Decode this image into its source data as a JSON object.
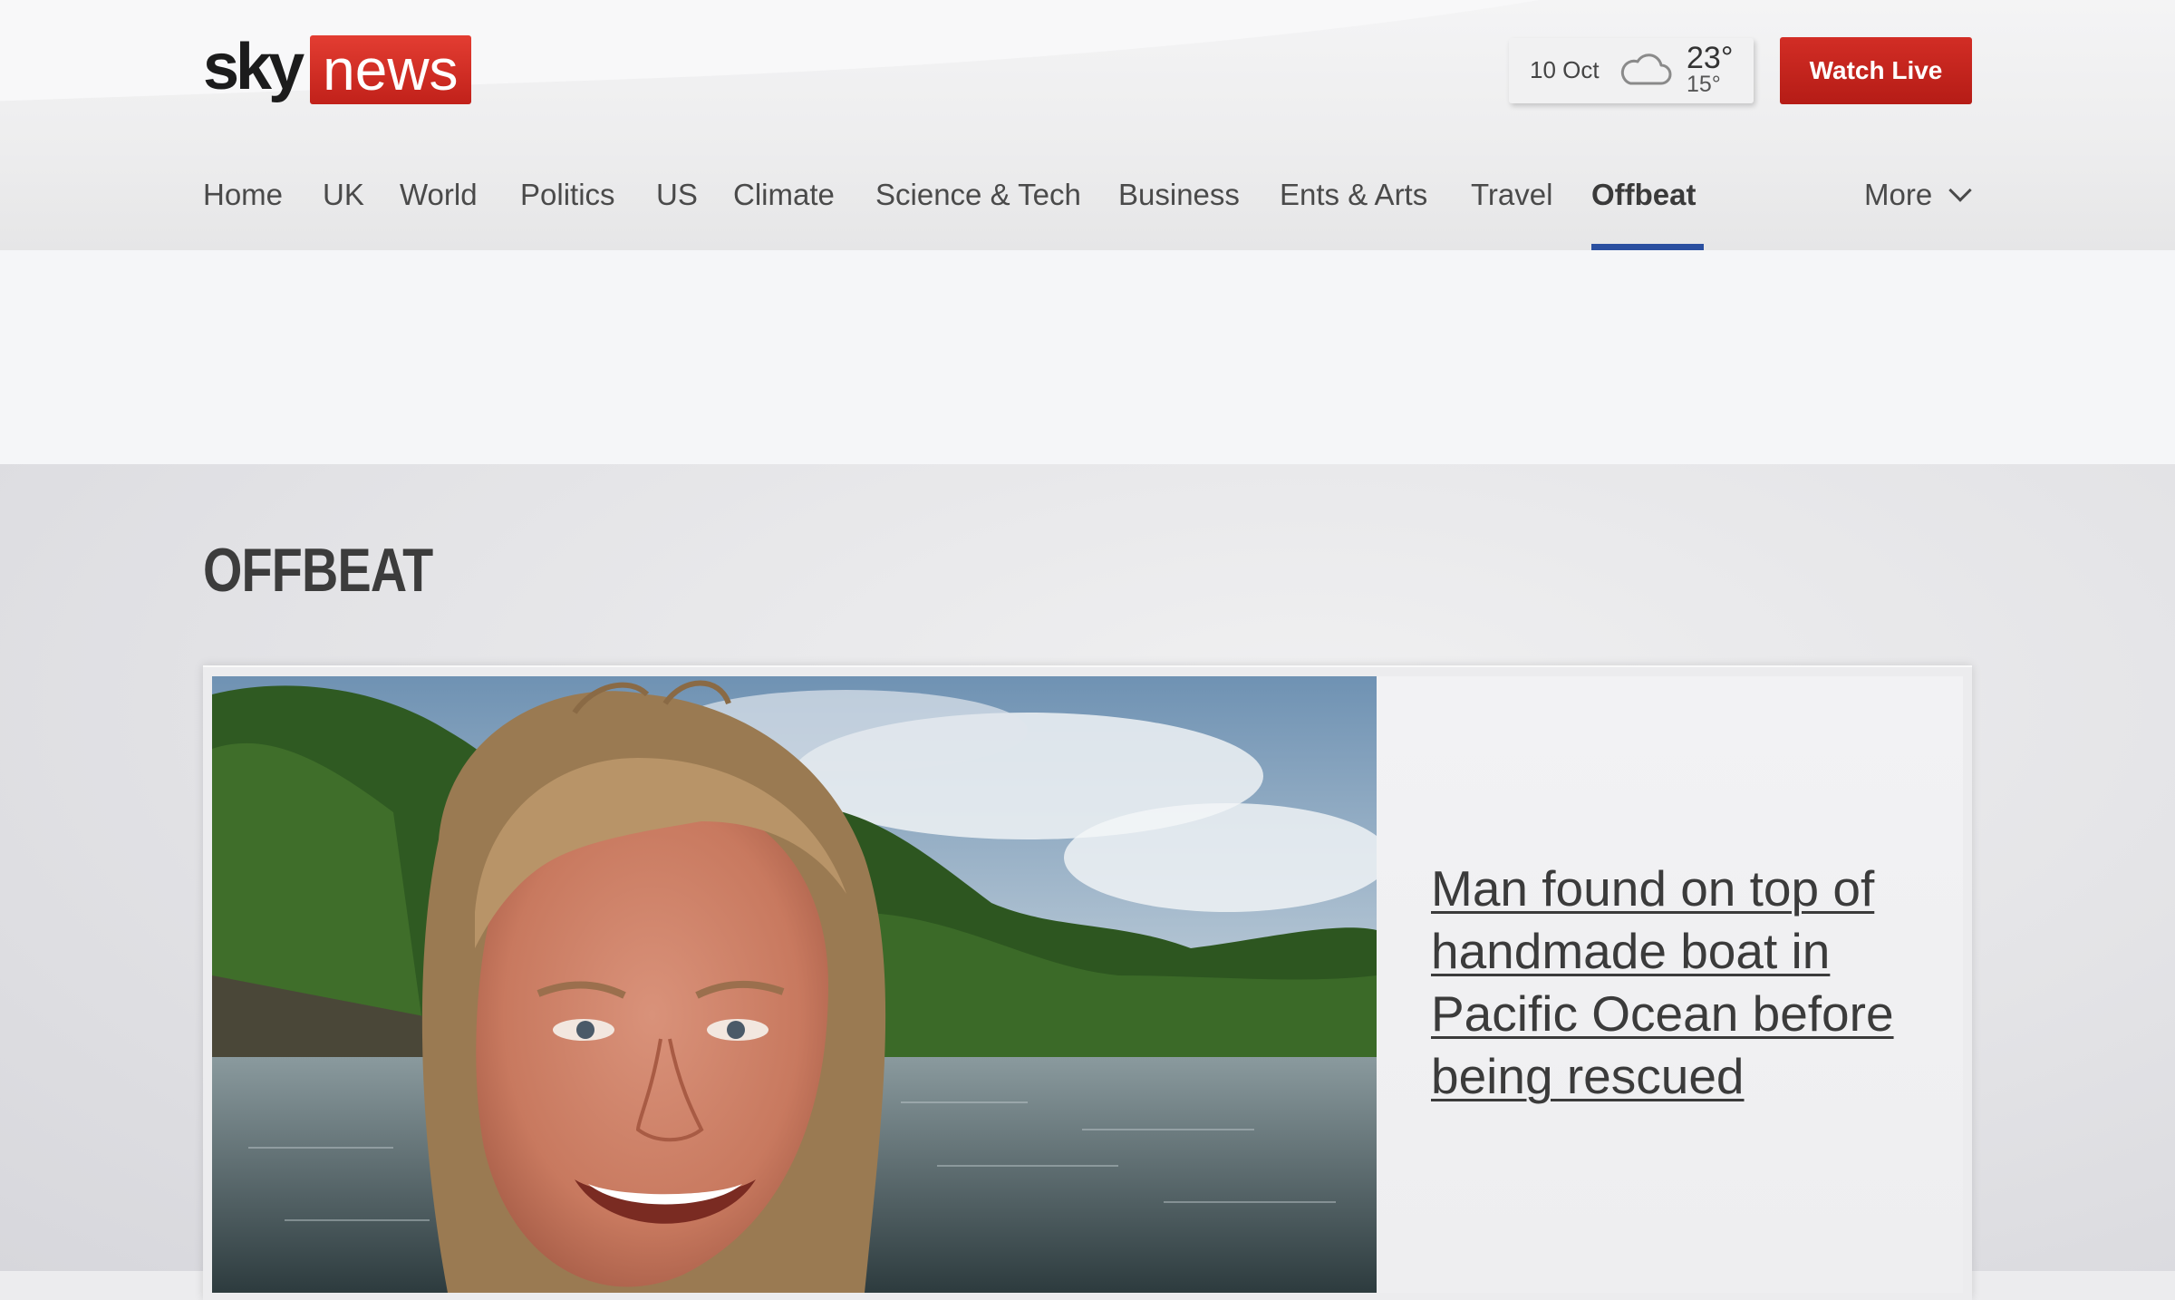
{
  "header": {
    "logo": {
      "sky": "sky",
      "news": "news"
    },
    "weather": {
      "date": "10 Oct",
      "icon": "cloud-icon",
      "high": "23°",
      "low": "15°"
    },
    "watch_live_label": "Watch Live"
  },
  "nav": {
    "items": [
      {
        "label": "Home"
      },
      {
        "label": "UK"
      },
      {
        "label": "World"
      },
      {
        "label": "Politics"
      },
      {
        "label": "US"
      },
      {
        "label": "Climate"
      },
      {
        "label": "Science & Tech"
      },
      {
        "label": "Business"
      },
      {
        "label": "Ents & Arts"
      },
      {
        "label": "Travel"
      },
      {
        "label": "Offbeat",
        "active": true
      }
    ],
    "more_label": "More",
    "more_icon": "chevron-down-icon"
  },
  "section": {
    "title": "OFFBEAT"
  },
  "featured": {
    "headline": "Man found on top of handmade boat in Pacific Ocean before being rescued",
    "image_subject": "smiling young man with curly blond hair in front of a green wooded coastline and water"
  },
  "colors": {
    "brand_red": "#c8241c",
    "nav_active_underline": "#2a4fa0"
  }
}
